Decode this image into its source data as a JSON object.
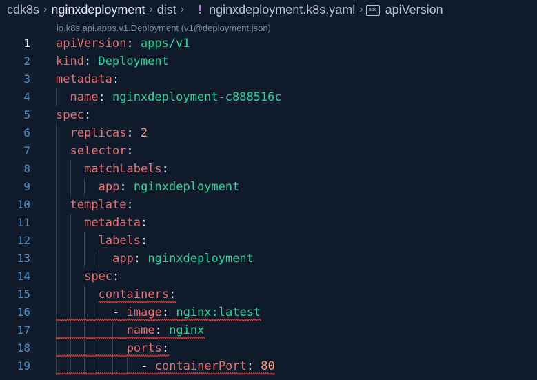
{
  "breadcrumb": {
    "items": [
      "cdk8s",
      "nginxdeployment",
      "dist",
      "nginxdeployment.k8s.yaml",
      "apiVersion"
    ],
    "file_icon": "exclamation-yaml-icon",
    "symbol_icon": "string-symbol-icon",
    "separator": "›"
  },
  "schema_hint": "io.k8s.api.apps.v1.Deployment (v1@deployment.json)",
  "editor": {
    "active_line": 1,
    "lines": [
      {
        "n": "1",
        "key": "apiVersion",
        "colon": ":",
        "value": "apps/v1"
      },
      {
        "n": "2",
        "key": "kind",
        "colon": ":",
        "value": "Deployment"
      },
      {
        "n": "3",
        "key": "metadata",
        "colon": ":",
        "value": ""
      },
      {
        "n": "4",
        "key": "name",
        "colon": ":",
        "value": "nginxdeployment-c888516c"
      },
      {
        "n": "5",
        "key": "spec",
        "colon": ":",
        "value": ""
      },
      {
        "n": "6",
        "key": "replicas",
        "colon": ":",
        "value": "2"
      },
      {
        "n": "7",
        "key": "selector",
        "colon": ":",
        "value": ""
      },
      {
        "n": "8",
        "key": "matchLabels",
        "colon": ":",
        "value": ""
      },
      {
        "n": "9",
        "key": "app",
        "colon": ":",
        "value": "nginxdeployment"
      },
      {
        "n": "10",
        "key": "template",
        "colon": ":",
        "value": ""
      },
      {
        "n": "11",
        "key": "metadata",
        "colon": ":",
        "value": ""
      },
      {
        "n": "12",
        "key": "labels",
        "colon": ":",
        "value": ""
      },
      {
        "n": "13",
        "key": "app",
        "colon": ":",
        "value": "nginxdeployment"
      },
      {
        "n": "14",
        "key": "spec",
        "colon": ":",
        "value": ""
      },
      {
        "n": "15",
        "key": "containers",
        "colon": ":",
        "value": ""
      },
      {
        "n": "16",
        "dash": "-",
        "key": "image",
        "colon": ":",
        "value": "nginx:latest"
      },
      {
        "n": "17",
        "key": "name",
        "colon": ":",
        "value": "nginx"
      },
      {
        "n": "18",
        "key": "ports",
        "colon": ":",
        "value": ""
      },
      {
        "n": "19",
        "dash": "-",
        "key": "containerPort",
        "colon": ":",
        "value": "80"
      }
    ]
  },
  "colors": {
    "background": "#0f1b2b",
    "key": "#ee6d6d",
    "string_value": "#27d79a",
    "number_value": "#ff9b7b",
    "line_number": "#4b8ec6",
    "error_squiggle": "#e03a3a"
  }
}
